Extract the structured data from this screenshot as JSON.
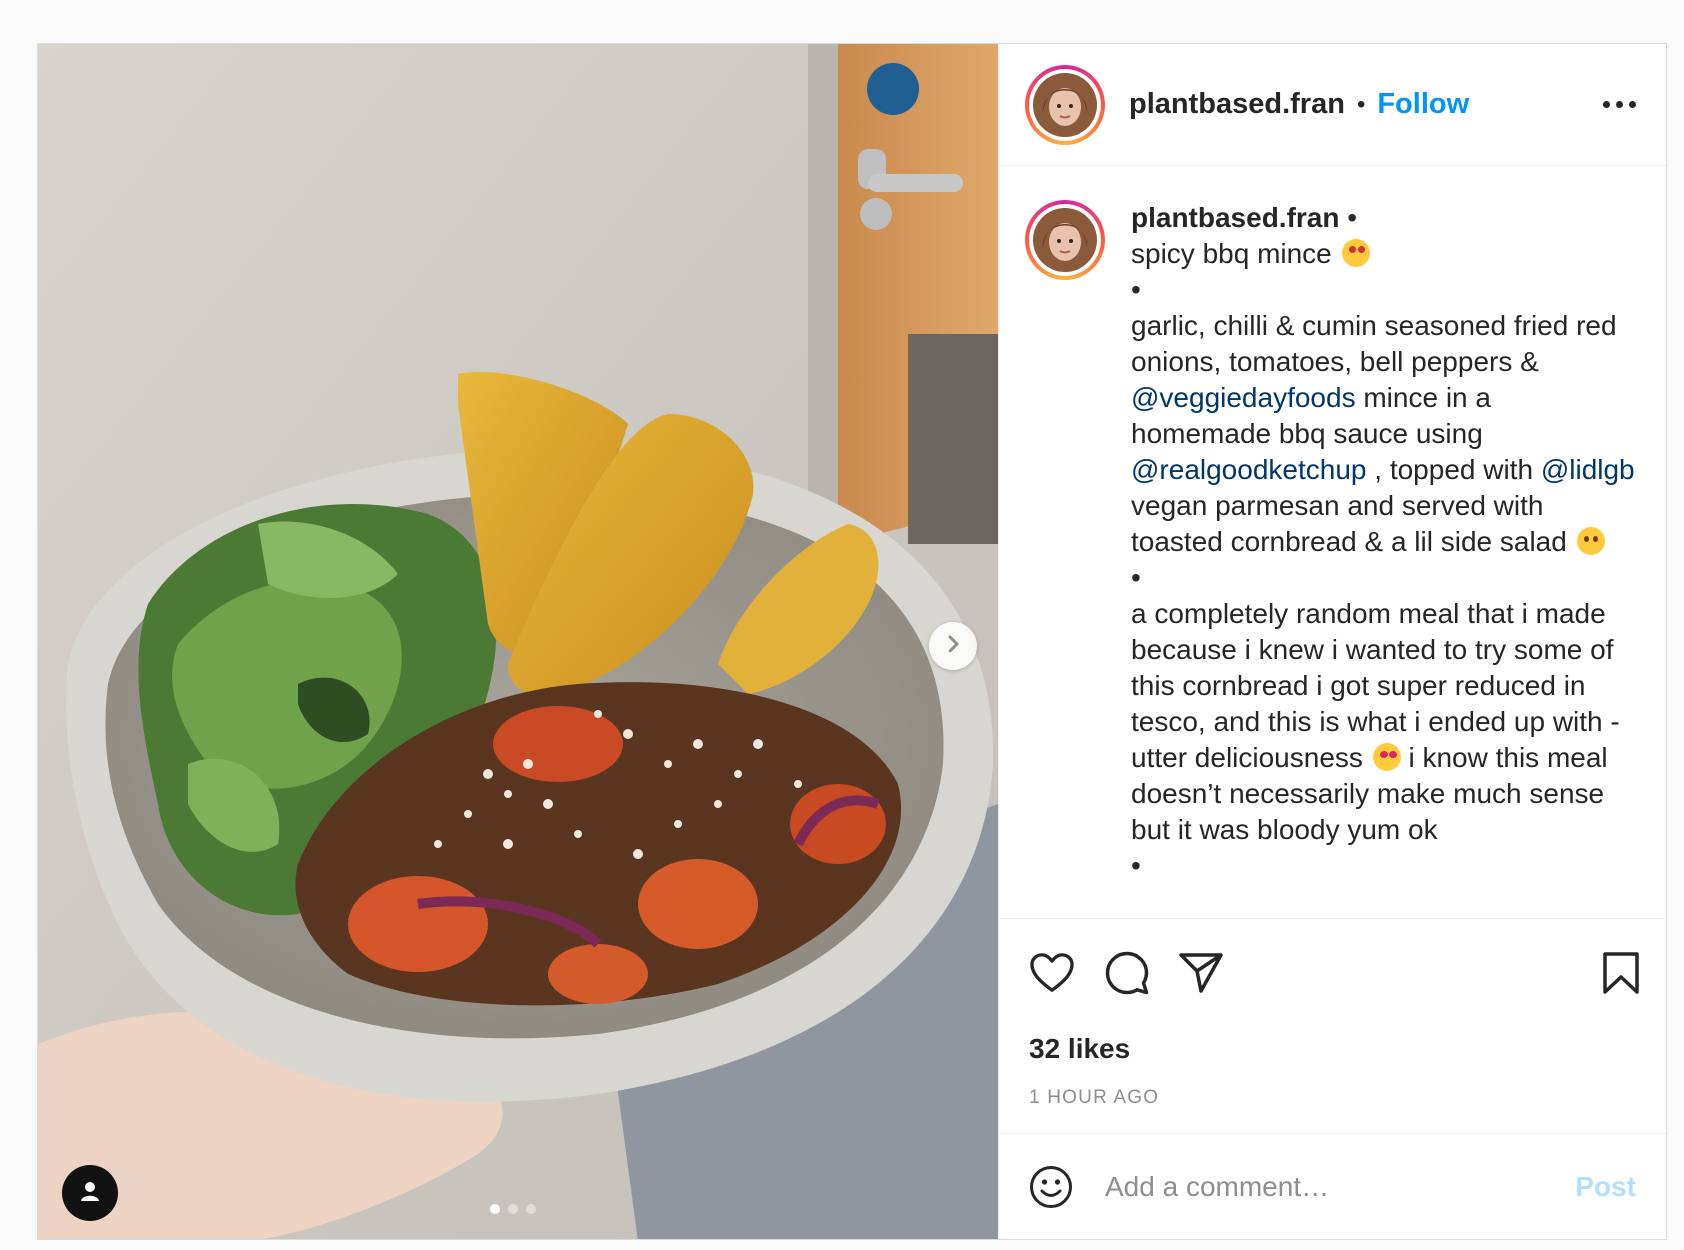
{
  "header": {
    "username": "plantbased.fran",
    "separator": "•",
    "follow_label": "Follow"
  },
  "caption": {
    "username": "plantbased.fran",
    "separator": "•",
    "title": "spicy bbq mince",
    "bullet": "•",
    "para1_a": "garlic, chilli & cumin seasoned fried red onions, tomatoes, bell peppers & ",
    "mention1": "@veggiedayfoods",
    "para1_b": " mince in a homemade bbq sauce using ",
    "mention2": "@realgoodketchup",
    "para1_c": " , topped with ",
    "mention3": "@lidlgb",
    "para1_d": " vegan parmesan and served with toasted cornbread & a lil side salad",
    "para2_a": "a completely random meal that i made because i knew i wanted to try some of this cornbread i got super reduced in tesco, and this is what i ended up with - utter deliciousness",
    "para2_b": " i know this meal doesn’t necessarily make much sense but it was bloody yum ok",
    "emoji_title": "star-struck-emoji",
    "emoji_salad": "yum-emoji",
    "emoji_delicious": "heart-eyes-emoji"
  },
  "stats": {
    "likes": "32 likes",
    "timestamp": "1 HOUR AGO"
  },
  "comment": {
    "placeholder": "Add a comment…",
    "post_label": "Post"
  },
  "carousel": {
    "count": 3,
    "active_index": 0
  },
  "icons": {
    "like": "heart-icon",
    "comment": "comment-bubble-icon",
    "share": "paper-plane-icon",
    "save": "bookmark-icon",
    "emoji": "smiley-icon",
    "more": "more-dots-icon",
    "next": "chevron-right-icon",
    "tagged": "user-tag-icon"
  },
  "colors": {
    "accent": "#0095f6",
    "post_disabled": "#b2dffc",
    "mention": "#00376b",
    "text": "#262626",
    "muted": "#8e8e8e"
  }
}
